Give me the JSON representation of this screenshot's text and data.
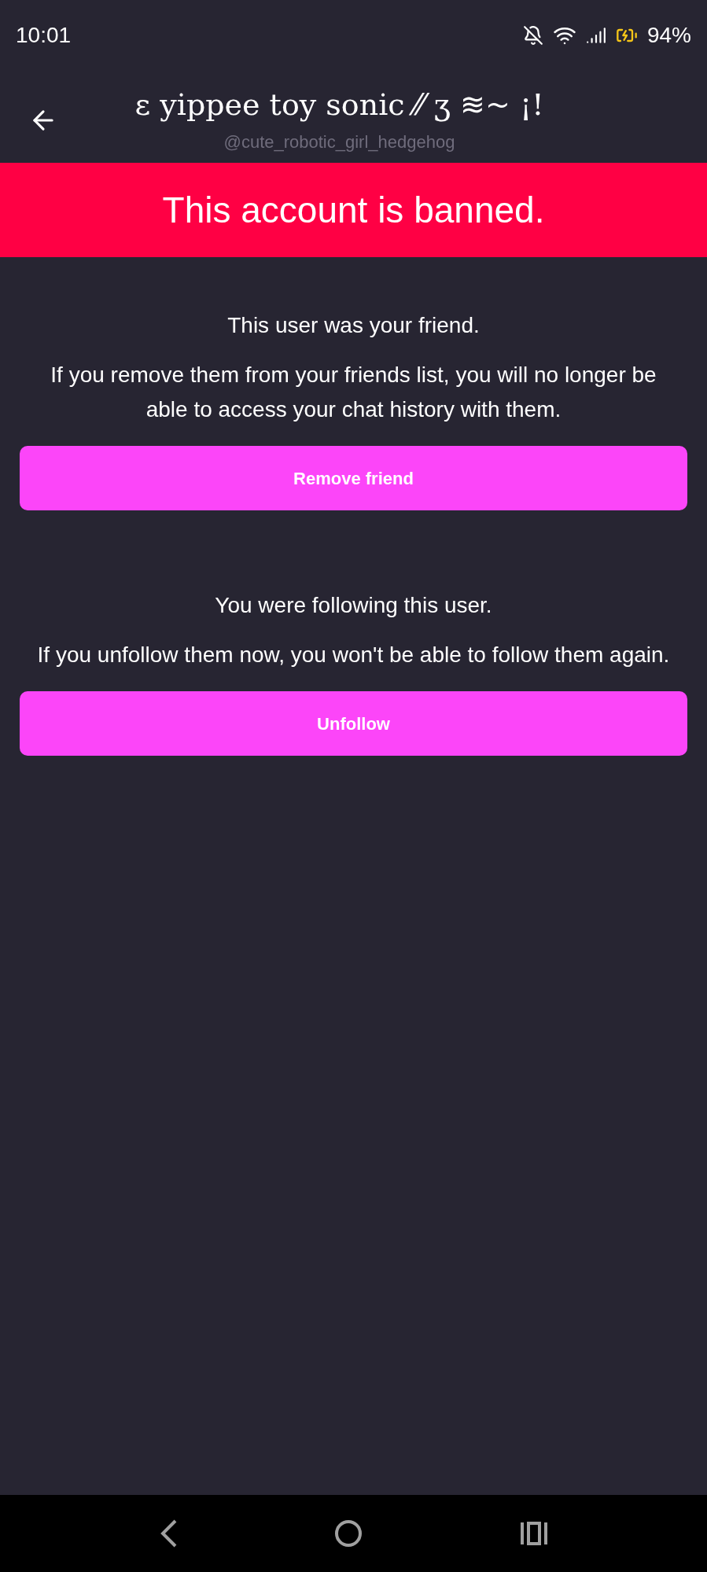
{
  "status_bar": {
    "time": "10:01",
    "battery": "94%"
  },
  "header": {
    "title": "ɛ yippee toy sonic ⁄⁄ ʒ ≋~ ¡!",
    "username": "@cute_robotic_girl_hedgehog"
  },
  "banner": "This account is banned.",
  "sections": [
    {
      "heading": "This user was your friend.",
      "message": "If you remove them from your friends list, you will no longer be able to access your chat history with them.",
      "button": "Remove friend"
    },
    {
      "heading": "You were following this user.",
      "message": "If you unfollow them now, you won't be able to follow them again.",
      "button": "Unfollow"
    }
  ]
}
